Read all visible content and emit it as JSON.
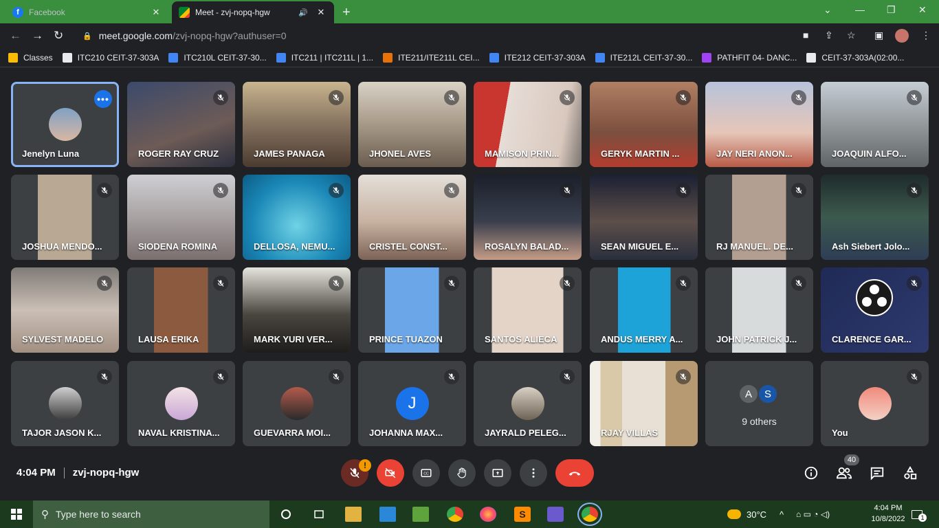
{
  "browser": {
    "tabs": [
      {
        "title": "Facebook",
        "active": false
      },
      {
        "title": "Meet - zvj-nopq-hgw",
        "active": true
      }
    ],
    "url_host": "meet.google.com",
    "url_path": "/zvj-nopq-hgw?authuser=0",
    "bookmarks": [
      {
        "label": "Classes"
      },
      {
        "label": "ITC210 CEIT-37-303A"
      },
      {
        "label": "ITC210L CEIT-37-30..."
      },
      {
        "label": "ITC211 | ITC211L | 1..."
      },
      {
        "label": "ITE211/ITE211L CEI..."
      },
      {
        "label": "ITE212 CEIT-37-303A"
      },
      {
        "label": "ITE212L CEIT-37-30..."
      },
      {
        "label": "PATHFIT 04- DANC..."
      },
      {
        "label": "CEIT-37-303A(02:00..."
      }
    ]
  },
  "participants": [
    {
      "name": "Jenelyn Luna"
    },
    {
      "name": "ROGER RAY CRUZ"
    },
    {
      "name": "JAMES PANAGA"
    },
    {
      "name": "JHONEL AVES"
    },
    {
      "name": "MAMISON PRIN..."
    },
    {
      "name": "GERYK MARTIN ..."
    },
    {
      "name": "JAY NERI ANON..."
    },
    {
      "name": "JOAQUIN ALFO..."
    },
    {
      "name": "JOSHUA MENDO..."
    },
    {
      "name": "SIODENA ROMINA"
    },
    {
      "name": "DELLOSA, NEMU..."
    },
    {
      "name": "CRISTEL CONST..."
    },
    {
      "name": "ROSALYN BALAD..."
    },
    {
      "name": "SEAN MIGUEL E..."
    },
    {
      "name": "RJ MANUEL. DE..."
    },
    {
      "name": "Ash Siebert Jolo..."
    },
    {
      "name": "SYLVEST MADELO"
    },
    {
      "name": "LAUSA ERIKA"
    },
    {
      "name": "MARK YURI VER..."
    },
    {
      "name": "PRINCE TUAZON"
    },
    {
      "name": "SANTOS ALIECA"
    },
    {
      "name": "ANDUS MERRY A..."
    },
    {
      "name": "JOHN PATRICK J..."
    },
    {
      "name": "CLARENCE GAR..."
    },
    {
      "name": "TAJOR JASON K..."
    },
    {
      "name": "NAVAL KRISTINA..."
    },
    {
      "name": "GUEVARRA MOI..."
    },
    {
      "name": "JOHANNA MAX...",
      "initial": "J"
    },
    {
      "name": "JAYRALD PELEG..."
    },
    {
      "name": "RJAY VILLAS"
    },
    {
      "name": "You"
    }
  ],
  "others": {
    "label": "9 others",
    "chips": [
      "A",
      "S"
    ]
  },
  "meeting": {
    "time": "4:04 PM",
    "code": "zvj-nopq-hgw",
    "mic_warning": "!",
    "people_count": "40"
  },
  "taskbar": {
    "search_placeholder": "Type here to search",
    "weather": "30°C",
    "time": "4:04 PM",
    "date": "10/8/2022",
    "notifications": "1"
  },
  "colors": {
    "meet_bg": "#202124",
    "tile_bg": "#3c4043",
    "hangup_red": "#ea4335",
    "pin_outline": "#8ab4f8",
    "accent_blue": "#1a73e8"
  }
}
